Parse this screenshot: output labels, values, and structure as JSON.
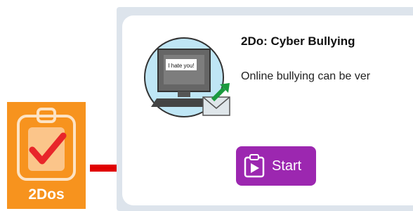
{
  "tile": {
    "label": "2Dos",
    "icon": "clipboard-check-icon",
    "color": "#f7931e"
  },
  "card": {
    "title": "2Do: Cyber Bullying",
    "description": "Online bullying can be ver",
    "thumbnail": {
      "screen_text": "I hate you!",
      "icon": "computer-envelope-icon"
    },
    "start_label": "Start",
    "start_icon": "clipboard-play-icon",
    "button_color": "#9c27b0"
  },
  "arrow_color": "#e00000"
}
